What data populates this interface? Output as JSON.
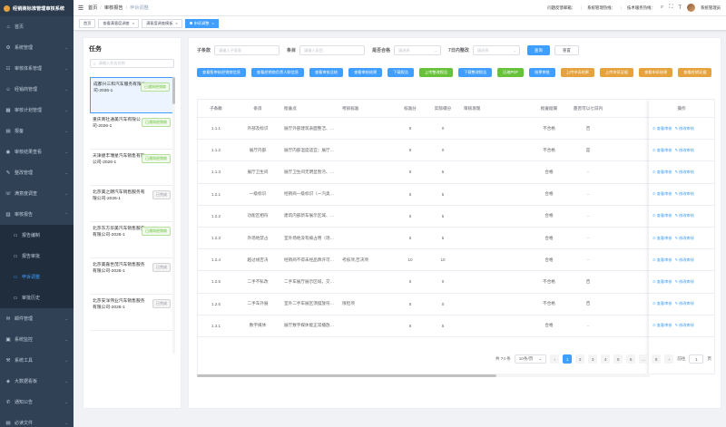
{
  "app": {
    "title": "经销商标准管理审核系统"
  },
  "sidebar": {
    "items": [
      {
        "label": "首页",
        "icon": "home-icon",
        "glyph": "⌂"
      },
      {
        "label": "系统管理",
        "icon": "settings-icon",
        "glyph": "⚙"
      },
      {
        "label": "审核体系管理",
        "icon": "tree-icon",
        "glyph": "☷"
      },
      {
        "label": "经销商管理",
        "icon": "user-icon",
        "glyph": "☺"
      },
      {
        "label": "审核计划管理",
        "icon": "calendar-icon",
        "glyph": "▦"
      },
      {
        "label": "报备",
        "icon": "document-icon",
        "glyph": "▤"
      },
      {
        "label": "审核结果查看",
        "icon": "eye-icon",
        "glyph": "◉"
      },
      {
        "label": "整改管理",
        "icon": "edit-icon",
        "glyph": "✎"
      },
      {
        "label": "满意度调查",
        "icon": "chat-icon",
        "glyph": "☏"
      },
      {
        "label": "审核报告",
        "icon": "report-icon",
        "glyph": "▥"
      }
    ],
    "subitems": [
      {
        "label": "报告编制",
        "icon": "file-edit-icon",
        "glyph": "▭"
      },
      {
        "label": "报告审批",
        "icon": "file-check-icon",
        "glyph": "▭"
      },
      {
        "label": "申诉调整",
        "icon": "file-appeal-icon",
        "glyph": "▭"
      },
      {
        "label": "审批历史",
        "icon": "history-icon",
        "glyph": "▭"
      }
    ],
    "items2": [
      {
        "label": "邮件管理",
        "icon": "mail-icon",
        "glyph": "✉"
      },
      {
        "label": "系统监控",
        "icon": "monitor-icon",
        "glyph": "▣"
      },
      {
        "label": "系统工具",
        "icon": "tool-icon",
        "glyph": "⚒"
      },
      {
        "label": "大数据看板",
        "icon": "dashboard-icon",
        "glyph": "◈"
      },
      {
        "label": "通知公告",
        "icon": "bell-icon",
        "glyph": "✆"
      },
      {
        "label": "必读文件",
        "icon": "folder-icon",
        "glyph": "▤"
      }
    ]
  },
  "navbar": {
    "breadcrumb": [
      "首页",
      "审核报告",
      "申诉调整"
    ],
    "feedback": "问题反馈邮箱：",
    "sys_hotline": "系统管理热线：",
    "tech_hotline": "技术服务热线：",
    "username": "系统管理员"
  },
  "tags": [
    {
      "label": "首页"
    },
    {
      "label": "查看满意度调查"
    },
    {
      "label": "满意度调查模板"
    },
    {
      "label": "申诉调整"
    }
  ],
  "task_panel": {
    "title": "任务",
    "search_placeholder": "请输入任务名称",
    "tasks": [
      {
        "name": "成都兴三和汽车服务有限公司-2026-1",
        "status": "已通知经销商",
        "done": false
      },
      {
        "name": "重庆商社通美汽车有限公司-2026-1",
        "status": "已通知经销商",
        "done": false
      },
      {
        "name": "天津捷丰瑞星汽车销售有限公司-2026-1",
        "status": "已通知经销商",
        "done": false
      },
      {
        "name": "北京美之朗汽车销售服务有限公司-2026-1",
        "status": "已完成",
        "done": true
      },
      {
        "name": "北京东方华美汽车销售服务有限公司-2026-1",
        "status": "已通知经销商",
        "done": false
      },
      {
        "name": "北京美嘉世茂汽车销售服务有限公司-2026-1",
        "status": "已完成",
        "done": true
      },
      {
        "name": "北京安洋伟业汽车销售服务有限公司-2026-1",
        "status": "已完成",
        "done": true
      }
    ]
  },
  "filter": {
    "sub_item_label": "子条款",
    "sub_item_placeholder": "请输入子条款",
    "clause_label": "条目",
    "clause_placeholder": "请输入条目",
    "pass_label": "是否合格",
    "pass_placeholder": "请选择",
    "rectify_label": "7日内整改",
    "rectify_placeholder": "请选择",
    "search_btn": "查询",
    "reset_btn": "重置"
  },
  "actions": [
    {
      "label": "查看智审核经销商信息",
      "color": "blue"
    },
    {
      "label": "查看经销商负责人联信息",
      "color": "blue"
    },
    {
      "label": "查看审核总结",
      "color": "blue"
    },
    {
      "label": "查看审核结果",
      "color": "blue"
    },
    {
      "label": "下载报告",
      "color": "blue"
    },
    {
      "label": "上传整改报告",
      "color": "green"
    },
    {
      "label": "下载整改报告",
      "color": "blue"
    },
    {
      "label": "压缩PDF",
      "color": "green"
    },
    {
      "label": "结果审批",
      "color": "blue"
    },
    {
      "label": "上传申诉结果",
      "color": "orange"
    },
    {
      "label": "上传申诉证据",
      "color": "orange"
    },
    {
      "label": "查看申诉结果",
      "color": "orange"
    },
    {
      "label": "查看经销证据",
      "color": "orange"
    }
  ],
  "table": {
    "headers": [
      "子条款",
      "条目",
      "检查点",
      "考核标准",
      "标准分",
      "实际得分",
      "审核发现",
      "检查结果",
      "是否可以七日内",
      "操作"
    ],
    "rows": [
      [
        "1.1.1",
        "外部及标识",
        "展厅外部建筑表面整洁、亮好…",
        "",
        "5",
        "0",
        "",
        "不合格",
        "否"
      ],
      [
        "1.1.2",
        "展厅内部",
        "展厅内部温度适宜；展厅…",
        "",
        "5",
        "0",
        "",
        "不合格",
        "是"
      ],
      [
        "1.1.3",
        "展厅卫生间",
        "展厅卫生间无明显暂污、积水…",
        "",
        "5",
        "5",
        "",
        "合格",
        "-"
      ],
      [
        "1.2.1",
        "一级标识",
        "经销商一级标识（一汽奥迪'…",
        "",
        "5",
        "5",
        "",
        "合格",
        "-"
      ],
      [
        "1.2.2",
        "功能区相符",
        "建筑内部新车展示区域、交车…",
        "",
        "5",
        "5",
        "",
        "合格",
        "-"
      ],
      [
        "1.2.3",
        "外场地禁占",
        "室外场地没有被占用（场地而…",
        "",
        "5",
        "5",
        "",
        "合格",
        "-"
      ],
      [
        "1.2.4",
        "越过线否决",
        "经销商不得未经品牌许可，出…",
        "考核项,否决项",
        "10",
        "10",
        "",
        "合格",
        "-"
      ],
      [
        "1.2.5",
        "二手不私改",
        "二手车展厅展示区域，交车间…",
        "",
        "5",
        "0",
        "",
        "不合格",
        "否"
      ],
      [
        "1.2.6",
        "二手车外展",
        "室外二手车展区须摆放符合奥…",
        "限检项",
        "5",
        "0",
        "",
        "不合格",
        "否"
      ],
      [
        "1.3.1",
        "数字媒体",
        "展厅数字媒体能正常播放、无…",
        "",
        "5",
        "5",
        "",
        "合格",
        "-"
      ]
    ],
    "op_view": "查看审核",
    "op_edit": "修改审核"
  },
  "pager": {
    "total": "共 74 条",
    "size": "10条/页",
    "pages": [
      "1",
      "2",
      "3",
      "4",
      "5",
      "6",
      "…",
      "8"
    ],
    "goto_label": "前往",
    "goto_value": "1",
    "page_unit": "页"
  },
  "colors": {
    "primary": "#409eff",
    "success": "#67c23a",
    "warning": "#e6a23c",
    "sidebar": "#304156"
  }
}
